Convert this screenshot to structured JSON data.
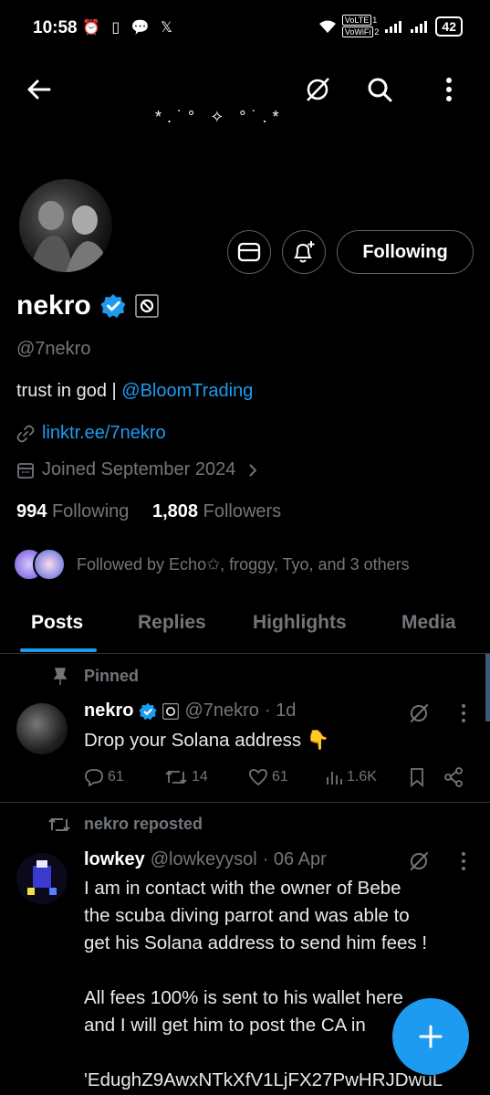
{
  "status_bar": {
    "time": "10:58",
    "left_icons": "⏰ ▯ 💬 𝕏",
    "volte_1": "VoLTE",
    "volte_2": "VoWiFi",
    "sim_1": "1",
    "sim_2": "2",
    "battery": "42"
  },
  "header": {
    "banner_decoration": "*.˙°  ✧  °˙.*"
  },
  "profile": {
    "name": "nekro",
    "handle": "@7nekro",
    "bio_text": "trust in god | ",
    "bio_link": "@BloomTrading",
    "website": "linktr.ee/7nekro",
    "joined": "Joined September 2024",
    "following_count": "994",
    "following_label": "Following",
    "followers_count": "1,808",
    "followers_label": "Followers",
    "followed_by": "Followed by Echo✩, froggy, Tyo, and 3 others",
    "following_button": "Following"
  },
  "tabs": [
    {
      "label": "Posts"
    },
    {
      "label": "Replies"
    },
    {
      "label": "Highlights"
    },
    {
      "label": "Media"
    }
  ],
  "posts": [
    {
      "context": "Pinned",
      "author": "nekro",
      "handle": "@7nekro",
      "time": "· 1d",
      "text": "Drop your Solana address 👇",
      "replies": "61",
      "reposts": "14",
      "likes": "61",
      "views": "1.6K"
    },
    {
      "context": "nekro reposted",
      "author": "lowkey",
      "handle": "@lowkeyysol",
      "time": "· 06 Apr",
      "lines": [
        "I am in contact with the owner of Bebe",
        "the scuba diving parrot and was able to",
        "get his Solana address to send him fees !",
        "",
        "All fees 100% is sent to his wallet here",
        "and I will get him to post the CA in",
        "",
        "'EdughZ9AwxNTkXfV1LjFX27PwHRJDwuL"
      ]
    }
  ],
  "colors": {
    "accent": "#1d9bf0",
    "muted": "#71767b",
    "border": "#2f3336"
  }
}
